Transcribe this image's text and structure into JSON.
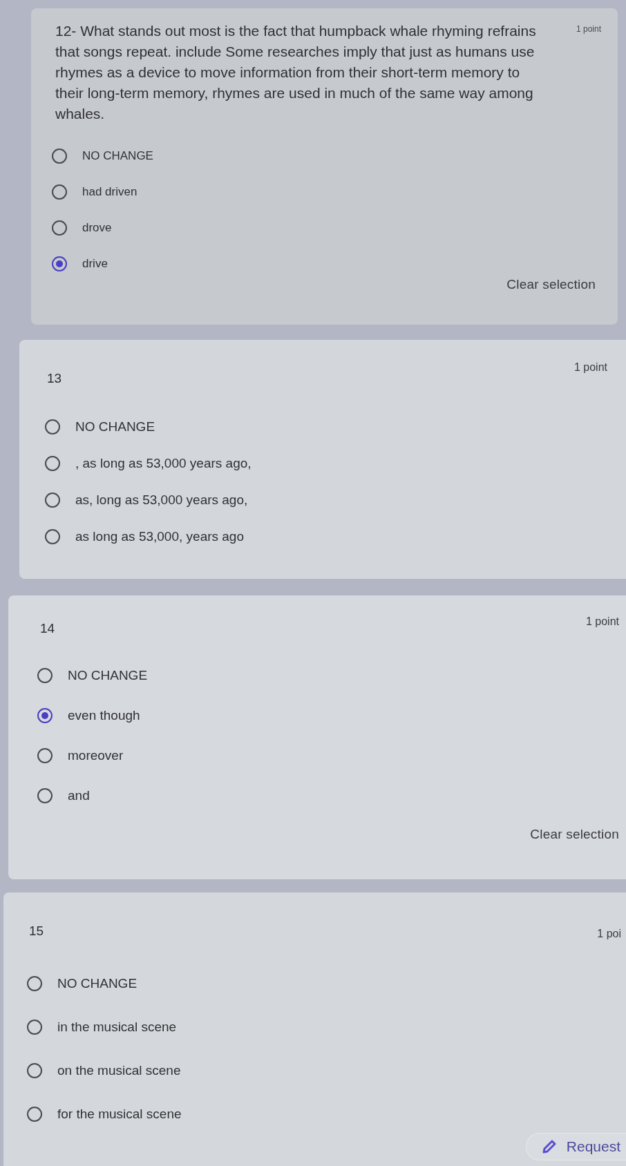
{
  "questions": [
    {
      "title": "12- What stands out most is the fact that humpback whale rhyming refrains that songs repeat. include Some researches imply that just as humans use rhymes as a device to move information from their short-term memory to their long-term memory, rhymes are used in much of the same way among whales.",
      "points": "1 point",
      "options": [
        {
          "label": "NO CHANGE",
          "selected": false
        },
        {
          "label": "had driven",
          "selected": false
        },
        {
          "label": "drove",
          "selected": false
        },
        {
          "label": "drive",
          "selected": true
        }
      ],
      "clear_selection": "Clear selection"
    },
    {
      "title": "13",
      "points": "1 point",
      "options": [
        {
          "label": "NO CHANGE",
          "selected": false
        },
        {
          "label": ", as long as 53,000 years ago,",
          "selected": false
        },
        {
          "label": "as, long as 53,000 years ago,",
          "selected": false
        },
        {
          "label": "as long as 53,000, years ago",
          "selected": false
        }
      ]
    },
    {
      "title": "14",
      "points": "1 point",
      "options": [
        {
          "label": "NO CHANGE",
          "selected": false
        },
        {
          "label": "even though",
          "selected": true
        },
        {
          "label": "moreover",
          "selected": false
        },
        {
          "label": "and",
          "selected": false
        }
      ],
      "clear_selection": "Clear selection"
    },
    {
      "title": "15",
      "points": "1 poi",
      "options": [
        {
          "label": "NO CHANGE",
          "selected": false
        },
        {
          "label": "in the musical scene",
          "selected": false
        },
        {
          "label": "on the musical scene",
          "selected": false
        },
        {
          "label": "for the musical scene",
          "selected": false
        }
      ]
    }
  ],
  "request_button": {
    "label": "Request"
  }
}
